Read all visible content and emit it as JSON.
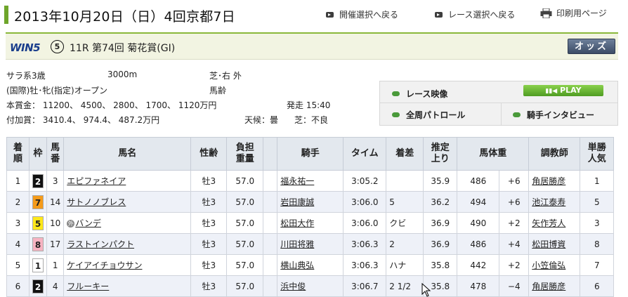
{
  "header": {
    "title": "2013年10月20日（日）4回京都7日",
    "links": [
      {
        "label": "開催選択へ戻る"
      },
      {
        "label": "レース選択へ戻る"
      },
      {
        "label": "印刷用ページ"
      }
    ]
  },
  "race": {
    "win5_label": "WIN5",
    "win5_leg": "5",
    "name": "11R  第74回  菊花賞(GI)",
    "odds_button": "オッズ"
  },
  "info": {
    "class": "サラ系3歳",
    "distance": "3000m",
    "course": "芝･右  外",
    "conditions": "(国際)牡･牝(指定)オープン",
    "weight_rule": "馬齢",
    "prize": "本賞金：  11200、 4500、 2800、 1700、 1120万円",
    "extra_prize": "付加賞：  3410.4、 974.4、 487.2万円",
    "post_time": "発走 15:40",
    "weather": "天候：曇",
    "going": "芝：不良"
  },
  "panel": {
    "video": "レース映像",
    "play": "PLAY",
    "patrol": "全周パトロール",
    "interview": "騎手インタビュー"
  },
  "table": {
    "headers": [
      "着\n順",
      "枠",
      "馬\n番",
      "馬名",
      "性齢",
      "負担\n重量",
      "",
      "騎手",
      "タイム",
      "着差",
      "推定\n上り",
      "馬体重",
      "",
      "調教師",
      "単勝\n人気"
    ],
    "rows": [
      {
        "pos": "1",
        "waku": "2",
        "num": "3",
        "horse": "エピファネイア",
        "mark": "",
        "sex": "牡3",
        "weight": "57.0",
        "jockey": "福永祐一",
        "time": "3:05.2",
        "margin": "",
        "last3f": "35.9",
        "body": "486",
        "diff": "+6",
        "trainer": "角居勝彦",
        "pop": "1"
      },
      {
        "pos": "2",
        "waku": "7",
        "num": "14",
        "horse": "サトノノブレス",
        "mark": "",
        "sex": "牡3",
        "weight": "57.0",
        "jockey": "岩田康誠",
        "time": "3:06.0",
        "margin": "5",
        "last3f": "36.2",
        "body": "494",
        "diff": "+6",
        "trainer": "池江泰寿",
        "pop": "5"
      },
      {
        "pos": "3",
        "waku": "5",
        "num": "10",
        "horse": "バンデ",
        "mark": "外",
        "sex": "牡3",
        "weight": "57.0",
        "jockey": "松田大作",
        "time": "3:06.0",
        "margin": "クビ",
        "last3f": "36.9",
        "body": "490",
        "diff": "+2",
        "trainer": "矢作芳人",
        "pop": "3"
      },
      {
        "pos": "4",
        "waku": "8",
        "num": "17",
        "horse": "ラストインパクト",
        "mark": "",
        "sex": "牡3",
        "weight": "57.0",
        "jockey": "川田将雅",
        "time": "3:06.3",
        "margin": "2",
        "last3f": "36.9",
        "body": "486",
        "diff": "+4",
        "trainer": "松田博資",
        "pop": "8"
      },
      {
        "pos": "5",
        "waku": "1",
        "num": "1",
        "horse": "ケイアイチョウサン",
        "mark": "",
        "sex": "牡3",
        "weight": "57.0",
        "jockey": "横山典弘",
        "time": "3:06.3",
        "margin": "ハナ",
        "last3f": "35.8",
        "body": "442",
        "diff": "+2",
        "trainer": "小笠倫弘",
        "pop": "7"
      },
      {
        "pos": "6",
        "waku": "2",
        "num": "4",
        "horse": "フルーキー",
        "mark": "",
        "sex": "牡3",
        "weight": "57.0",
        "jockey": "浜中俊",
        "time": "3:06.7",
        "margin": "2 1/2",
        "last3f": "35.8",
        "body": "478",
        "diff": "−4",
        "trainer": "角居勝彦",
        "pop": "6"
      }
    ]
  },
  "waku_colors": {
    "1": [
      "#ffffff",
      "#222"
    ],
    "2": [
      "#111111",
      "#fff"
    ],
    "3": [
      "#e33b3b",
      "#fff"
    ],
    "4": [
      "#2f5fd0",
      "#fff"
    ],
    "5": [
      "#ffe81a",
      "#222"
    ],
    "6": [
      "#3aa83a",
      "#fff"
    ],
    "7": [
      "#f59b1a",
      "#222"
    ],
    "8": [
      "#f7b3c2",
      "#222"
    ]
  }
}
